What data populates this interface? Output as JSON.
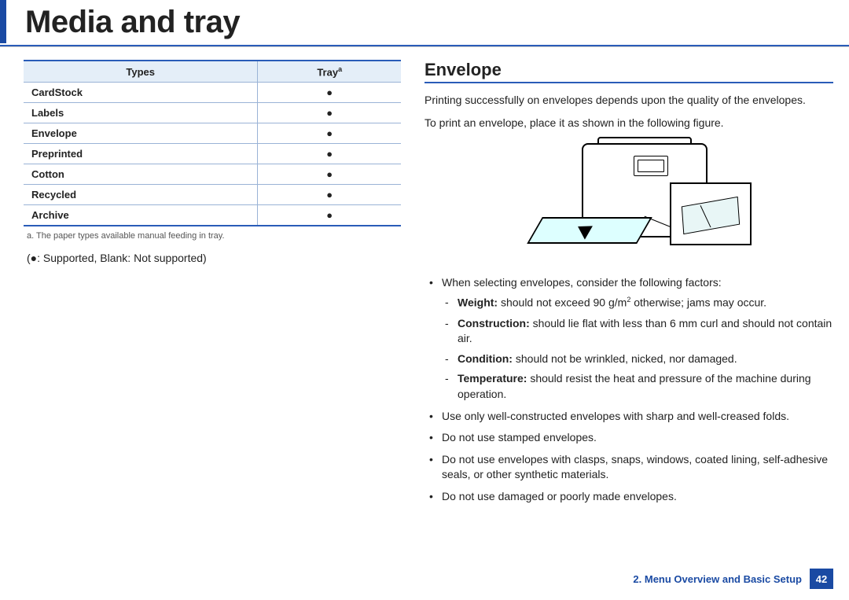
{
  "title": "Media and tray",
  "table": {
    "headers": {
      "types": "Types",
      "tray": "Tray",
      "tray_sup": "a"
    },
    "rows": [
      {
        "name": "CardStock",
        "mark": "●"
      },
      {
        "name": "Labels",
        "mark": "●"
      },
      {
        "name": "Envelope",
        "mark": "●"
      },
      {
        "name": "Preprinted",
        "mark": "●"
      },
      {
        "name": "Cotton",
        "mark": "●"
      },
      {
        "name": "Recycled",
        "mark": "●"
      },
      {
        "name": "Archive",
        "mark": "●"
      }
    ],
    "footnote": "a. The paper types available manual feeding in tray.",
    "legend": "(●: Supported, Blank: Not supported)"
  },
  "right": {
    "heading": "Envelope",
    "p1": "Printing successfully on envelopes depends upon the quality of the envelopes.",
    "p2": "To print an envelope, place it as shown in the following figure.",
    "b1": "When selecting envelopes, consider the following factors:",
    "factors": {
      "weight_label": "Weight:",
      "weight_text": " should not exceed 90 g/m",
      "weight_sup": "2",
      "weight_tail": " otherwise; jams may occur.",
      "constr_label": "Construction:",
      "constr_text": " should lie flat with less than 6 mm curl and should not contain air.",
      "cond_label": "Condition:",
      "cond_text": " should not be wrinkled, nicked, nor damaged.",
      "temp_label": "Temperature:",
      "temp_text": " should resist the heat and pressure of the machine during operation."
    },
    "b2": "Use only well-constructed envelopes with sharp and well-creased folds.",
    "b3": "Do not use stamped envelopes.",
    "b4": "Do not use envelopes with clasps, snaps, windows, coated lining, self-adhesive seals, or other synthetic materials.",
    "b5": "Do not use damaged or poorly made envelopes."
  },
  "footer": {
    "chapter": "2. Menu Overview and Basic Setup",
    "page": "42"
  }
}
